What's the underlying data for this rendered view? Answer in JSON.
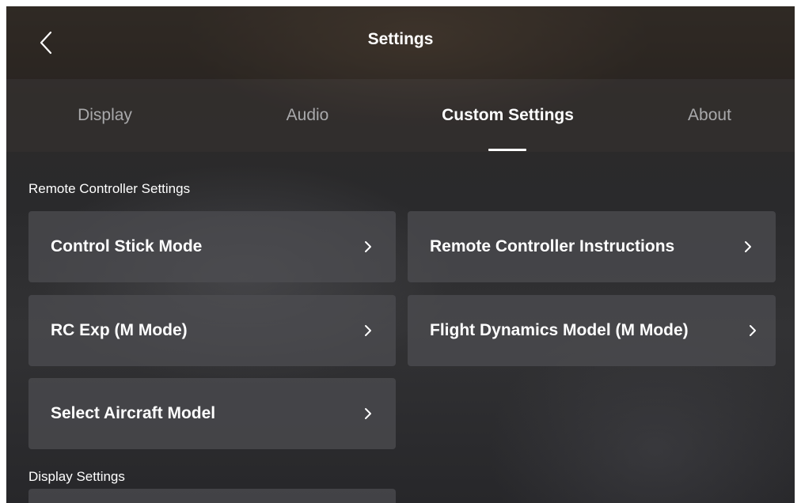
{
  "header": {
    "title": "Settings",
    "back_icon": "chevron-left-icon"
  },
  "tabs": [
    {
      "label": "Display",
      "active": false
    },
    {
      "label": "Audio",
      "active": false
    },
    {
      "label": "Custom Settings",
      "active": true
    },
    {
      "label": "About",
      "active": false
    }
  ],
  "sections": {
    "remote_controller": {
      "label": "Remote Controller Settings",
      "items": [
        {
          "label": "Control Stick Mode",
          "icon": "chevron-right-icon"
        },
        {
          "label": "Remote Controller Instructions",
          "icon": "chevron-right-icon"
        },
        {
          "label": "RC Exp (M Mode)",
          "icon": "chevron-right-icon"
        },
        {
          "label": "Flight Dynamics Model (M Mode)",
          "icon": "chevron-right-icon"
        },
        {
          "label": "Select Aircraft Model",
          "icon": "chevron-right-icon"
        }
      ]
    },
    "display": {
      "label": "Display Settings"
    }
  },
  "colors": {
    "text_primary": "#ffffff",
    "text_inactive": "#a9a9ab",
    "card_bg": "#4e4e52"
  }
}
